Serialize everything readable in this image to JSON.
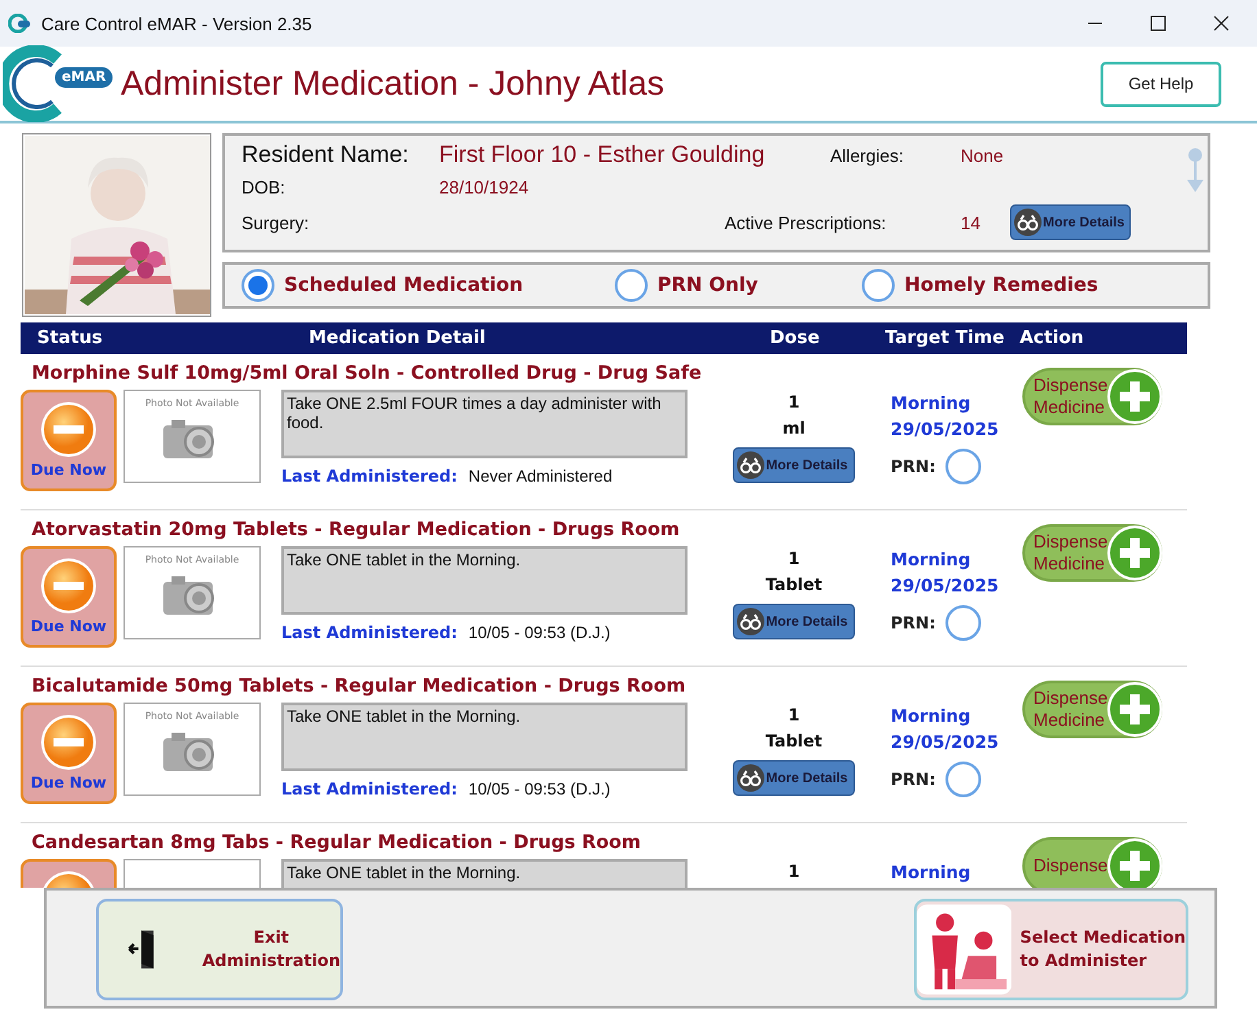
{
  "window": {
    "title": "Care Control eMAR - Version 2.35"
  },
  "header": {
    "logo_badge": "eMAR",
    "title": "Administer Medication - Johny Atlas",
    "help_button": "Get Help"
  },
  "resident": {
    "name_label": "Resident Name:",
    "name": "First Floor 10 - Esther Goulding",
    "allergies_label": "Allergies:",
    "allergies": "None",
    "dob_label": "DOB:",
    "dob": "28/10/1924",
    "surgery_label": "Surgery:",
    "prescriptions_label": "Active Prescriptions:",
    "prescriptions": "14",
    "more_details": "More Details"
  },
  "filters": [
    {
      "label": "Scheduled Medication",
      "selected": true
    },
    {
      "label": "PRN Only",
      "selected": false
    },
    {
      "label": "Homely Remedies",
      "selected": false
    }
  ],
  "table": {
    "columns": [
      "Status",
      "Medication Detail",
      "Dose",
      "Target Time",
      "Action"
    ],
    "rows": [
      {
        "title": "Morphine Sulf 10mg/5ml Oral Soln - Controlled Drug - Drug Safe",
        "status": "Due Now",
        "photo": "Photo Not Available",
        "instructions": "Take ONE 2.5ml FOUR times a day administer with food.",
        "last_label": "Last Administered:",
        "last": "Never Administered",
        "dose": [
          "1",
          "ml"
        ],
        "more_details": "More Details",
        "time": "Morning",
        "date": "29/05/2025",
        "prn_label": "PRN:",
        "prn_checked": false,
        "action": [
          "Dispense",
          "Medicine"
        ]
      },
      {
        "title": "Atorvastatin 20mg Tablets - Regular Medication - Drugs Room",
        "status": "Due Now",
        "photo": "Photo Not Available",
        "instructions": "Take ONE tablet in the Morning.",
        "last_label": "Last Administered:",
        "last": "10/05 - 09:53 (D.J.)",
        "dose": [
          "1",
          "Tablet"
        ],
        "more_details": "More Details",
        "time": "Morning",
        "date": "29/05/2025",
        "prn_label": "PRN:",
        "prn_checked": false,
        "action": [
          "Dispense",
          "Medicine"
        ]
      },
      {
        "title": "Bicalutamide 50mg Tablets - Regular Medication - Drugs Room",
        "status": "Due Now",
        "photo": "Photo Not Available",
        "instructions": "Take ONE tablet in the Morning.",
        "last_label": "Last Administered:",
        "last": "10/05 - 09:53 (D.J.)",
        "dose": [
          "1",
          "Tablet"
        ],
        "more_details": "More Details",
        "time": "Morning",
        "date": "29/05/2025",
        "prn_label": "PRN:",
        "prn_checked": false,
        "action": [
          "Dispense",
          "Medicine"
        ]
      },
      {
        "title": "Candesartan 8mg Tabs - Regular Medication - Drugs Room",
        "instructions": "Take ONE tablet in the Morning.",
        "dose": [
          "1"
        ],
        "time": "Morning",
        "action": [
          "Dispense"
        ]
      }
    ]
  },
  "footer": {
    "exit": [
      "Exit",
      "Administration"
    ],
    "select": [
      "Select Medication",
      "to Administer"
    ]
  }
}
